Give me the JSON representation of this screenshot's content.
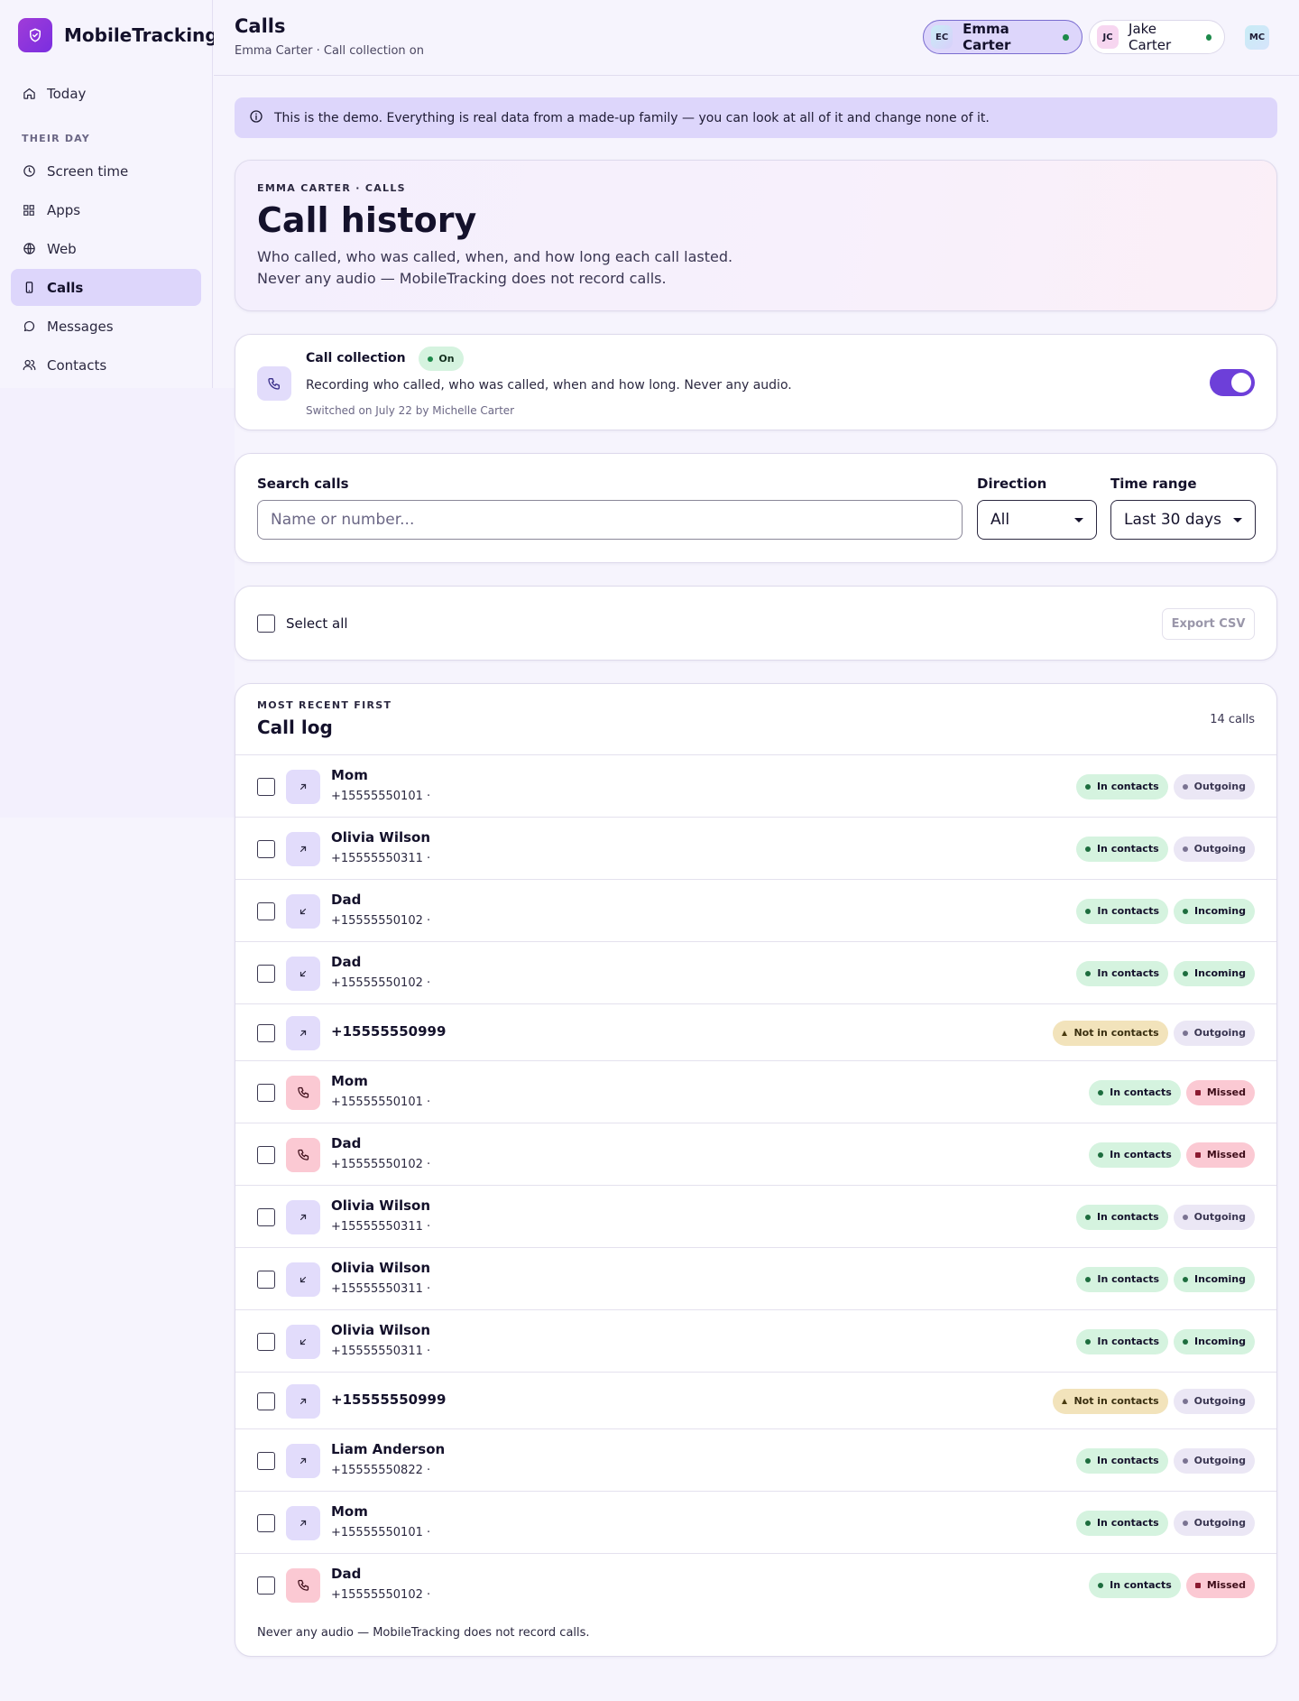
{
  "app": {
    "name": "MobileTracking"
  },
  "sidebar": {
    "items": [
      {
        "label": "Today",
        "icon": "home-icon"
      },
      {
        "label": "Screen time",
        "icon": "clock-icon"
      },
      {
        "label": "Apps",
        "icon": "grid-icon"
      },
      {
        "label": "Web",
        "icon": "globe-icon"
      },
      {
        "label": "Calls",
        "icon": "phone-icon",
        "active": true
      },
      {
        "label": "Messages",
        "icon": "chat-icon"
      },
      {
        "label": "Contacts",
        "icon": "people-icon"
      }
    ],
    "section_label": "THEIR DAY"
  },
  "header": {
    "title": "Calls",
    "subtitle": "Emma Carter · Call collection on",
    "profiles": [
      {
        "initials": "EC",
        "name": "Emma Carter",
        "selected": true
      },
      {
        "initials": "JC",
        "name": "Jake Carter",
        "selected": false
      }
    ],
    "me_initials": "MC"
  },
  "banner": {
    "text": "This is the demo. Everything is real data from a made-up family — you can look at all of it and change none of it."
  },
  "hero": {
    "eyebrow": "EMMA CARTER · CALLS",
    "title": "Call history",
    "description": "Who called, who was called, when, and how long each call lasted. Never any audio — MobileTracking does not record calls."
  },
  "collection": {
    "title": "Call collection",
    "status": "On",
    "description": "Recording who called, who was called, when and how long. Never any audio.",
    "meta": "Switched on July 22 by Michelle Carter",
    "enabled": true
  },
  "filters": {
    "search_label": "Search calls",
    "search_placeholder": "Name or number...",
    "search_value": "",
    "direction_label": "Direction",
    "direction_value": "All",
    "range_label": "Time range",
    "range_value": "Last 30 days"
  },
  "selection": {
    "select_all_label": "Select all",
    "export_label": "Export CSV"
  },
  "call_log": {
    "eyebrow": "MOST RECENT FIRST",
    "title": "Call log",
    "count_label": "14 calls",
    "footnote": "Never any audio — MobileTracking does not record calls.",
    "rows": [
      {
        "name": "Mom",
        "number": "+15555550101 ·",
        "contact": "In contacts",
        "direction": "Outgoing"
      },
      {
        "name": "Olivia Wilson",
        "number": "+15555550311 ·",
        "contact": "In contacts",
        "direction": "Outgoing"
      },
      {
        "name": "Dad",
        "number": "+15555550102 ·",
        "contact": "In contacts",
        "direction": "Incoming"
      },
      {
        "name": "Dad",
        "number": "+15555550102 ·",
        "contact": "In contacts",
        "direction": "Incoming"
      },
      {
        "name": "+15555550999",
        "number": "",
        "contact": "Not in contacts",
        "direction": "Outgoing"
      },
      {
        "name": "Mom",
        "number": "+15555550101 ·",
        "contact": "In contacts",
        "direction": "Missed"
      },
      {
        "name": "Dad",
        "number": "+15555550102 ·",
        "contact": "In contacts",
        "direction": "Missed"
      },
      {
        "name": "Olivia Wilson",
        "number": "+15555550311 ·",
        "contact": "In contacts",
        "direction": "Outgoing"
      },
      {
        "name": "Olivia Wilson",
        "number": "+15555550311 ·",
        "contact": "In contacts",
        "direction": "Incoming"
      },
      {
        "name": "Olivia Wilson",
        "number": "+15555550311 ·",
        "contact": "In contacts",
        "direction": "Incoming"
      },
      {
        "name": "+15555550999",
        "number": "",
        "contact": "Not in contacts",
        "direction": "Outgoing"
      },
      {
        "name": "Liam Anderson",
        "number": "+15555550822 ·",
        "contact": "In contacts",
        "direction": "Outgoing"
      },
      {
        "name": "Mom",
        "number": "+15555550101 ·",
        "contact": "In contacts",
        "direction": "Outgoing"
      },
      {
        "name": "Dad",
        "number": "+15555550102 ·",
        "contact": "In contacts",
        "direction": "Missed"
      }
    ]
  },
  "colors": {
    "accent": "#6d3fd9",
    "brand": "#a03cd8",
    "contact_green": "#d5f3df",
    "missed_red": "#fbc9d3",
    "not_contact_amber": "#f2e3bb"
  }
}
